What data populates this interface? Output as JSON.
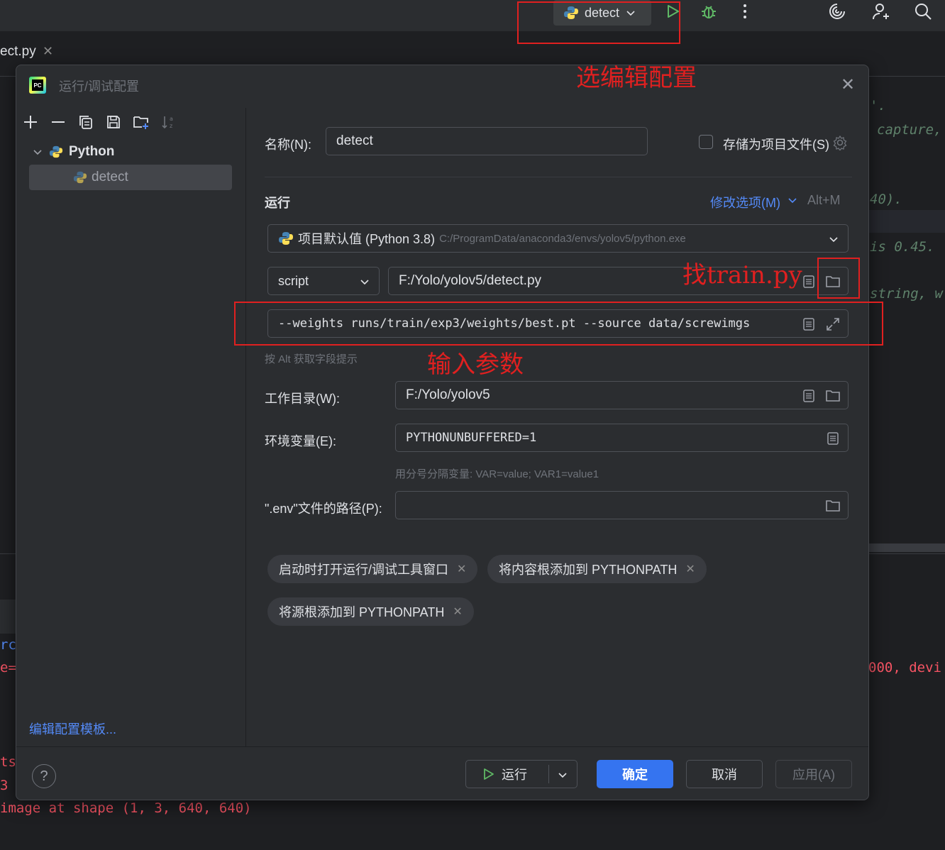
{
  "topbar": {
    "run_config_label": "detect",
    "icons": [
      "python-icon",
      "chevron-down-icon",
      "run-icon",
      "debug-icon",
      "more-icon",
      "ai-spiral-icon",
      "add-user-icon",
      "search-icon"
    ]
  },
  "editor": {
    "tab_label": "ect.py",
    "tab_close": "✕",
    "code_fragments": [
      "'.",
      "capture,",
      "40).",
      "is 0.45.",
      "string, w",
      "000, devi"
    ]
  },
  "console": {
    "lines": [
      "rc",
      "e=",
      "ts",
      " 3",
      "image at shape (1, 3, 640, 640)"
    ]
  },
  "dialog": {
    "title": "运行/调试配置",
    "tree": {
      "group": "Python",
      "item": "detect"
    },
    "edit_templates_link": "编辑配置模板...",
    "name_label": "名称(N):",
    "name_value": "detect",
    "store_checkbox_label": "存储为项目文件(S)",
    "run_section_label": "运行",
    "modify_options_link": "修改选项(M)",
    "modify_options_shortcut": "Alt+M",
    "interpreter_label": "项目默认值 (Python 3.8)",
    "interpreter_path": "C:/ProgramData/anaconda3/envs/yolov5/python.exe",
    "script_type": "script",
    "script_path": "F:/Yolo/yolov5/detect.py",
    "parameters": "--weights runs/train/exp3/weights/best.pt --source data/screwimgs",
    "alt_hint": "按 Alt 获取字段提示",
    "workdir_label": "工作目录(W):",
    "workdir_value": "F:/Yolo/yolov5",
    "env_label": "环境变量(E):",
    "env_value": "PYTHONUNBUFFERED=1",
    "env_hint": "用分号分隔变量: VAR=value; VAR1=value1",
    "dotenv_label": "\".env\"文件的路径(P):",
    "dotenv_value": "",
    "chips": [
      "启动时打开运行/调试工具窗口",
      "将内容根添加到 PYTHONPATH",
      "将源根添加到 PYTHONPATH"
    ],
    "buttons": {
      "run": "运行",
      "ok": "确定",
      "cancel": "取消",
      "apply": "应用(A)"
    }
  },
  "annotations": {
    "select_config": "选编辑配置",
    "find_train": "找train.py",
    "enter_params": "输入参数"
  },
  "colors": {
    "accent": "#3574f0",
    "annotation_red": "#e02020",
    "link": "#548af7"
  }
}
